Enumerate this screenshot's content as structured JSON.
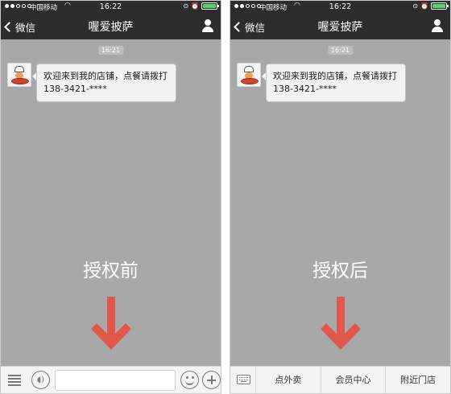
{
  "status_bar": {
    "carrier": "中国移动",
    "time": "16:22"
  },
  "nav": {
    "back_label": "微信",
    "title": "喔爱披萨"
  },
  "chat": {
    "timestamp": "16:21",
    "message": "欢迎来到我的店铺，点餐请拨打138-3421-****"
  },
  "panels": {
    "before": {
      "caption": "授权前"
    },
    "after": {
      "caption": "授权后"
    }
  },
  "after_menu": {
    "items": [
      "点外卖",
      "会员中心",
      "附近门店"
    ]
  },
  "colors": {
    "arrow": "#e2574c",
    "nav_bg": "#2d2d2d",
    "chat_bg": "#a8a8a8",
    "battery": "#4cd964"
  },
  "icons": [
    "menu-icon",
    "voice-icon",
    "emoji-icon",
    "plus-icon",
    "keyboard-icon",
    "person-icon",
    "chevron-left-icon",
    "wifi-icon",
    "battery-icon"
  ]
}
